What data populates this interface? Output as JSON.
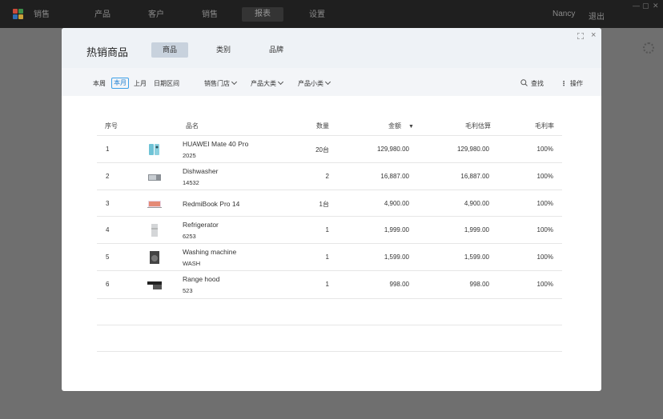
{
  "app": {
    "nav": [
      "销售",
      "产品",
      "客户",
      "销售",
      "报表",
      "设置"
    ],
    "active_nav": "报表",
    "user": "Nancy",
    "logout": "退出"
  },
  "modal": {
    "title": "热销商品",
    "tabs": [
      "商品",
      "类别",
      "品牌"
    ],
    "active_tab": "商品",
    "filters": {
      "this_week": "本周",
      "this_month": "本月",
      "last_month": "上月",
      "date_range": "日期区间",
      "store": "销售门店",
      "category": "产品大类",
      "subcategory": "产品小类",
      "search": "查找",
      "actions": "操作"
    },
    "columns": [
      "序号",
      "品名",
      "数量",
      "金额",
      "毛利估算",
      "毛利率"
    ],
    "sort_indicator": "▼",
    "rows": [
      {
        "idx": "1",
        "name": "HUAWEI Mate 40 Pro",
        "code": "2025",
        "qty": "20台",
        "amount": "129,980.00",
        "profit": "129,980.00",
        "rate": "100%"
      },
      {
        "idx": "2",
        "name": "Dishwasher",
        "code": "14532",
        "qty": "2",
        "amount": "16,887.00",
        "profit": "16,887.00",
        "rate": "100%"
      },
      {
        "idx": "3",
        "name": "RedmiBook Pro 14",
        "code": "",
        "qty": "1台",
        "amount": "4,900.00",
        "profit": "4,900.00",
        "rate": "100%"
      },
      {
        "idx": "4",
        "name": "Refrigerator",
        "code": "6253",
        "qty": "1",
        "amount": "1,999.00",
        "profit": "1,999.00",
        "rate": "100%"
      },
      {
        "idx": "5",
        "name": "Washing machine",
        "code": "WASH",
        "qty": "1",
        "amount": "1,599.00",
        "profit": "1,599.00",
        "rate": "100%"
      },
      {
        "idx": "6",
        "name": "Range hood",
        "code": "523",
        "qty": "1",
        "amount": "998.00",
        "profit": "998.00",
        "rate": "100%"
      }
    ]
  },
  "colors": {
    "accent": "#3da0e8",
    "active_tab_bg": "#c8d2dd",
    "header_bg": "#eef2f6",
    "topbar": "#1f1f1f"
  },
  "icons": {
    "product_images": [
      "phone-image",
      "dishwasher-image",
      "laptop-image",
      "refrigerator-image",
      "washing-machine-image",
      "range-hood-image"
    ]
  }
}
